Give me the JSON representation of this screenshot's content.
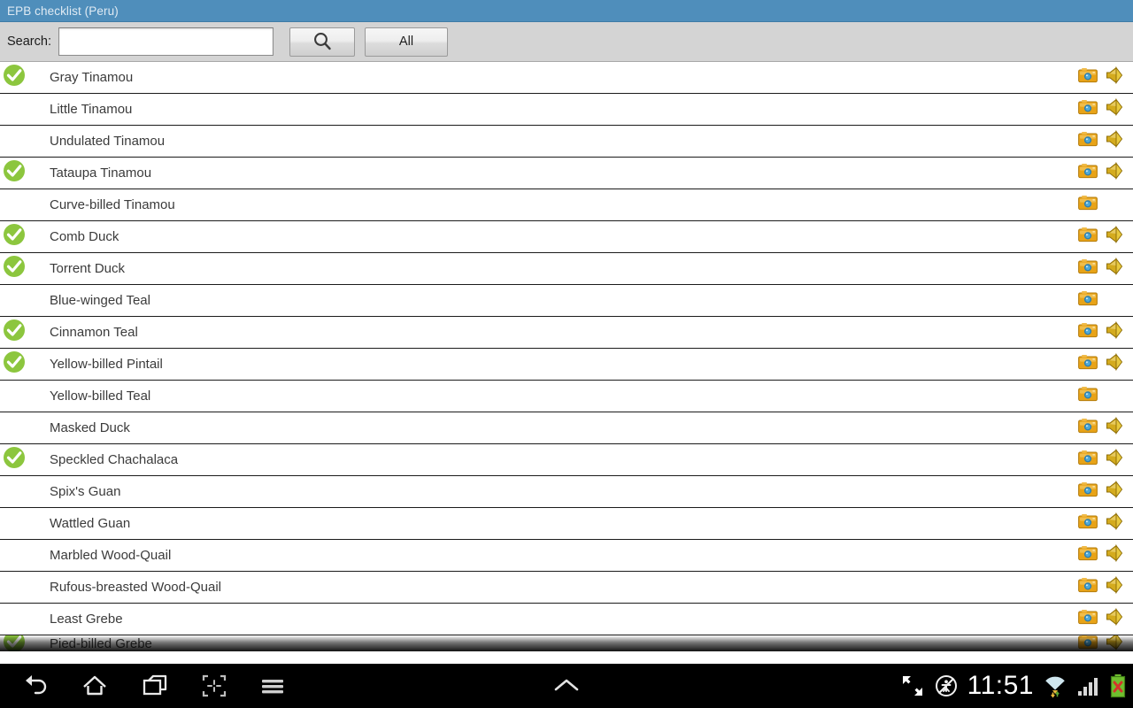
{
  "titlebar": {
    "title": "EPB checklist (Peru)"
  },
  "search": {
    "label": "Search:",
    "value": "",
    "placeholder": "",
    "search_button_icon": "magnifier-icon",
    "all_button_label": "All"
  },
  "list": {
    "rows": [
      {
        "name": "Gray Tinamou",
        "checked": true,
        "photo": true,
        "sound": true
      },
      {
        "name": "Little Tinamou",
        "checked": false,
        "photo": true,
        "sound": true
      },
      {
        "name": "Undulated Tinamou",
        "checked": false,
        "photo": true,
        "sound": true
      },
      {
        "name": "Tataupa Tinamou",
        "checked": true,
        "photo": true,
        "sound": true
      },
      {
        "name": "Curve-billed Tinamou",
        "checked": false,
        "photo": true,
        "sound": false
      },
      {
        "name": "Comb Duck",
        "checked": true,
        "photo": true,
        "sound": true
      },
      {
        "name": "Torrent Duck",
        "checked": true,
        "photo": true,
        "sound": true
      },
      {
        "name": "Blue-winged Teal",
        "checked": false,
        "photo": true,
        "sound": false
      },
      {
        "name": "Cinnamon Teal",
        "checked": true,
        "photo": true,
        "sound": true
      },
      {
        "name": "Yellow-billed Pintail",
        "checked": true,
        "photo": true,
        "sound": true
      },
      {
        "name": "Yellow-billed Teal",
        "checked": false,
        "photo": true,
        "sound": false
      },
      {
        "name": "Masked Duck",
        "checked": false,
        "photo": true,
        "sound": true
      },
      {
        "name": "Speckled Chachalaca",
        "checked": true,
        "photo": true,
        "sound": true
      },
      {
        "name": "Spix's Guan",
        "checked": false,
        "photo": true,
        "sound": true
      },
      {
        "name": "Wattled Guan",
        "checked": false,
        "photo": true,
        "sound": true
      },
      {
        "name": "Marbled Wood-Quail",
        "checked": false,
        "photo": true,
        "sound": true
      },
      {
        "name": "Rufous-breasted Wood-Quail",
        "checked": false,
        "photo": true,
        "sound": true
      },
      {
        "name": "Least Grebe",
        "checked": false,
        "photo": true,
        "sound": true
      }
    ],
    "partial_row": {
      "name": "Pied-billed Grebe",
      "checked": true,
      "photo": true,
      "sound": true
    },
    "icons": {
      "photo": "camera-icon",
      "sound": "speaker-icon",
      "checked": "green-check-icon"
    }
  },
  "navbar": {
    "back_icon": "back-arrow-icon",
    "home_icon": "home-icon",
    "recents_icon": "recent-apps-icon",
    "screenshot_icon": "screenshot-capture-icon",
    "menu_icon": "hamburger-menu-icon",
    "expand_icon": "caret-up-icon",
    "fullscreen_icon": "fullscreen-expand-icon",
    "rotation_lock_icon": "rotation-lock-icon",
    "clock": "11:51",
    "wifi_icon": "wifi-icon",
    "signal_icon": "cellular-signal-icon",
    "battery_icon": "battery-error-icon"
  },
  "colors": {
    "titlebar_bg": "#4f8ebb",
    "searchbar_bg": "#d4d4d4",
    "check_green": "#8cc63e",
    "camera_orange": "#e8a317",
    "speaker_gold": "#d4ab1e",
    "navbar_bg": "#000000"
  }
}
